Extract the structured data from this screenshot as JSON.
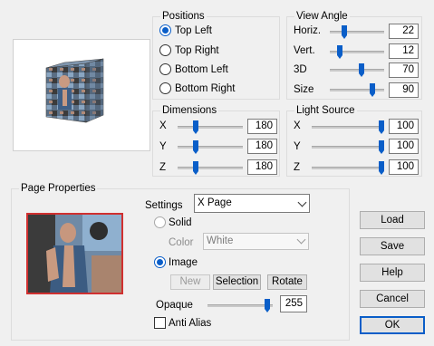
{
  "positions": {
    "title": "Positions",
    "options": [
      "Top Left",
      "Top Right",
      "Bottom Left",
      "Bottom Right"
    ],
    "selected": "Top Left"
  },
  "view_angle": {
    "title": "View Angle",
    "horiz": {
      "label": "Horiz.",
      "value": "22"
    },
    "vert": {
      "label": "Vert.",
      "value": "12"
    },
    "3d": {
      "label": "3D",
      "value": "70"
    },
    "size": {
      "label": "Size",
      "value": "90"
    }
  },
  "dimensions": {
    "title": "Dimensions",
    "x": {
      "label": "X",
      "value": "180"
    },
    "y": {
      "label": "Y",
      "value": "180"
    },
    "z": {
      "label": "Z",
      "value": "180"
    }
  },
  "light_source": {
    "title": "Light Source",
    "x": {
      "label": "X",
      "value": "100"
    },
    "y": {
      "label": "Y",
      "value": "100"
    },
    "z": {
      "label": "Z",
      "value": "100"
    }
  },
  "page_properties": {
    "title": "Page Properties",
    "settings_label": "Settings",
    "settings_value": "X Page",
    "solid_label": "Solid",
    "color_label": "Color",
    "color_value": "White",
    "image_label": "Image",
    "new_label": "New",
    "selection_label": "Selection",
    "rotate_label": "Rotate",
    "opaque_label": "Opaque",
    "opaque_value": "255",
    "anti_alias_label": "Anti Alias"
  },
  "buttons": {
    "load": "Load",
    "save": "Save",
    "help": "Help",
    "cancel": "Cancel",
    "ok": "OK"
  },
  "colors": {
    "accent": "#0a5ec8",
    "thumbnail_border": "#d03030",
    "image_dark": "#3a3a3a",
    "image_blue": "#5f86aa"
  },
  "slider_levels": {
    "view_horiz": 0.22,
    "view_vert": 0.12,
    "view_3d": 0.7,
    "view_size": 0.9,
    "dim_x": 0.45,
    "dim_y": 0.45,
    "dim_z": 0.45,
    "light_x": 1.0,
    "light_y": 1.0,
    "light_z": 1.0,
    "opaque": 1.0
  }
}
